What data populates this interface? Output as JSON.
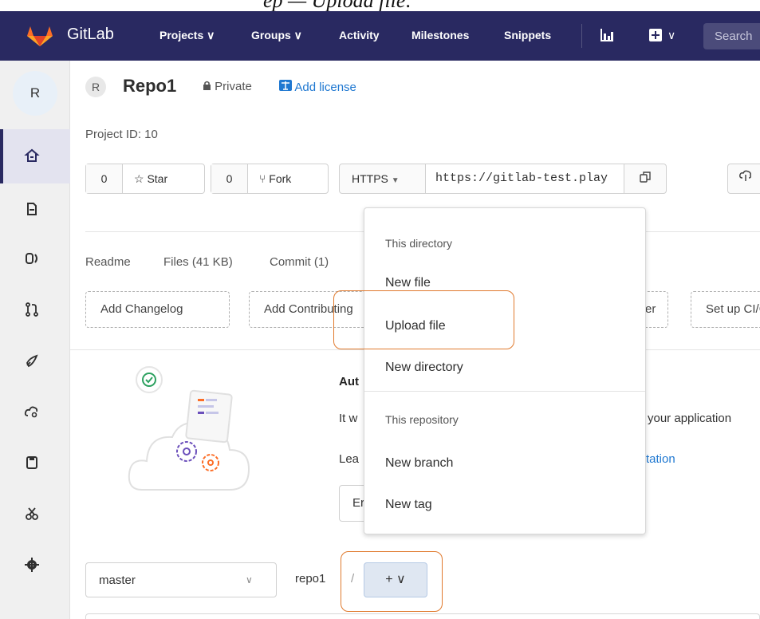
{
  "caption": {
    "text": "ep — Upload file:"
  },
  "navbar": {
    "brand": "GitLab",
    "items": [
      {
        "label": "Projects ∨"
      },
      {
        "label": "Groups ∨"
      },
      {
        "label": "Activity"
      },
      {
        "label": "Milestones"
      },
      {
        "label": "Snippets"
      }
    ],
    "new_menu_caret": "∨",
    "search_placeholder": "Search",
    "accent": "#292961"
  },
  "sidebar": {
    "avatar_letter": "R",
    "icons": [
      "home-icon",
      "repository-icon",
      "issues-icon",
      "merge-requests-icon",
      "ci-cd-icon",
      "operations-icon",
      "wiki-icon",
      "snippets-icon",
      "settings-icon"
    ]
  },
  "project": {
    "avatar_letter": "R",
    "name": "Repo1",
    "visibility": "Private",
    "add_license": "Add license",
    "id_text": "Project ID: 10"
  },
  "actions": {
    "star_count": "0",
    "star_label": "Star",
    "fork_count": "0",
    "fork_label": "Fork",
    "protocol": "HTTPS",
    "clone_url": "https://gitlab-test.play"
  },
  "stats": {
    "readme": "Readme",
    "files": "Files (41 KB)",
    "commits": "Commit (1)"
  },
  "quick_add": [
    "Add Changelog",
    "Add Contributing",
    "er",
    "Set up CI/CD"
  ],
  "autodevops": {
    "title": "Aut",
    "desc": "It w",
    "desc_tail": "your application",
    "learn": "Lea",
    "learn_link": "tation",
    "enable": "Er"
  },
  "tree": {
    "branch": "master",
    "path": "repo1",
    "separator": "/",
    "add_button": "+ ∨"
  },
  "dropdown": {
    "section1": "This directory",
    "new_file": "New file",
    "upload_file": "Upload file",
    "new_directory": "New directory",
    "section2": "This repository",
    "new_branch": "New branch",
    "new_tag": "New tag"
  },
  "highlight_color": "#e07a2e",
  "link_color": "#1f78d1"
}
